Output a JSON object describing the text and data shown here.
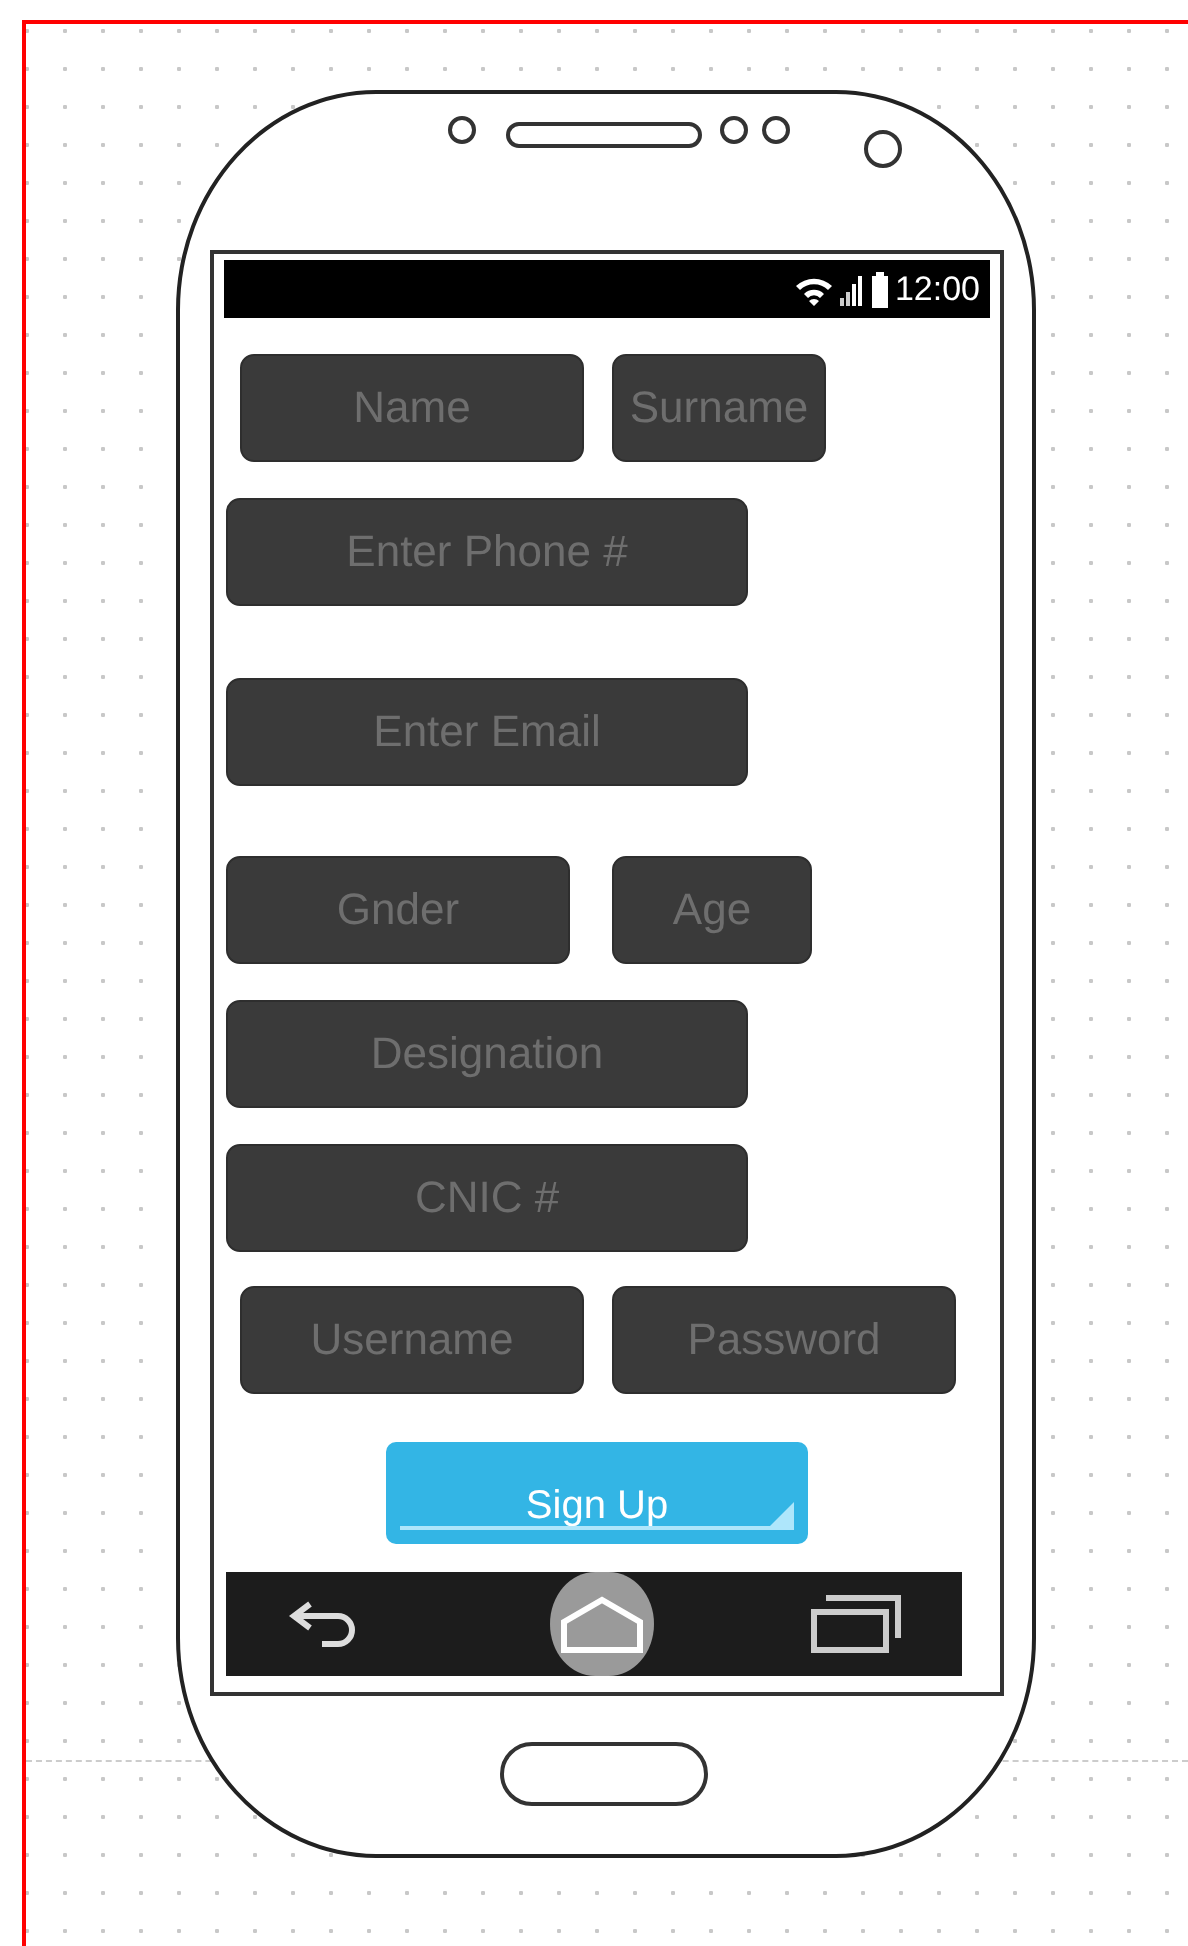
{
  "status_bar": {
    "time": "12:00"
  },
  "rows": [
    {
      "fields": [
        {
          "placeholder": "Name"
        },
        {
          "placeholder": "Surname"
        }
      ]
    },
    {
      "fields": [
        {
          "placeholder": "Enter Phone #"
        }
      ]
    },
    {
      "fields": [
        {
          "placeholder": "Enter Email"
        }
      ]
    },
    {
      "fields": [
        {
          "placeholder": "Gnder"
        },
        {
          "placeholder": "Age"
        }
      ]
    },
    {
      "fields": [
        {
          "placeholder": "Designation"
        }
      ]
    },
    {
      "fields": [
        {
          "placeholder": "CNIC #"
        }
      ]
    },
    {
      "fields": [
        {
          "placeholder": "Username"
        },
        {
          "placeholder": "Password"
        }
      ]
    }
  ],
  "button": {
    "label": "Sign Up"
  }
}
